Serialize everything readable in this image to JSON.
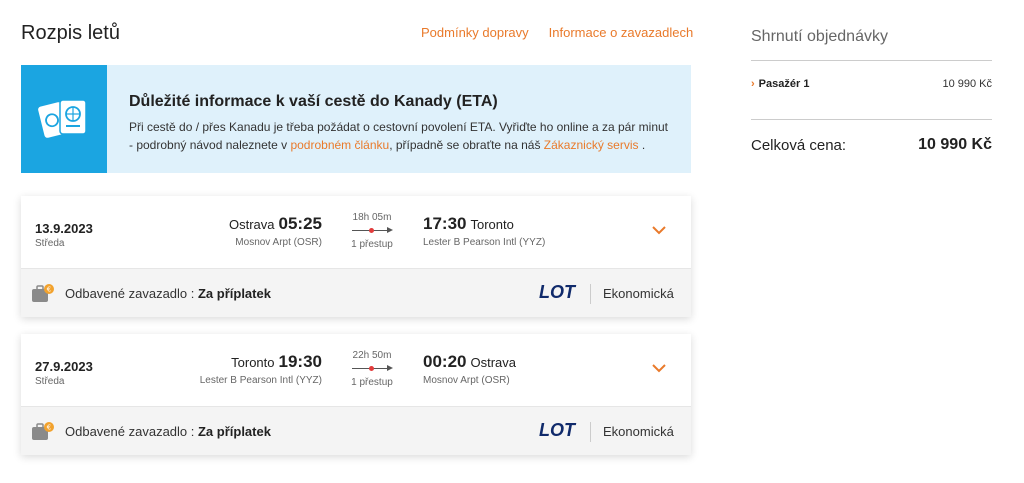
{
  "header": {
    "title": "Rozpis letů",
    "links": [
      "Podmínky dopravy",
      "Informace o zavazadlech"
    ]
  },
  "info": {
    "title": "Důležité informace k vaší cestě do Kanady (ETA)",
    "text_part1": "Při cestě do / přes Kanadu je třeba požádat o cestovní povolení ETA. Vyřiďte ho online a za pár minut - podrobný návod naleznete v ",
    "link1": "podrobném článku",
    "text_part2": ", případně se obraťte na náš ",
    "link2": "Zákaznický servis",
    "text_part3": " .",
    "icon": "passport-icon"
  },
  "flights": [
    {
      "date": "13.9.2023",
      "day": "Středa",
      "from_city": "Ostrava",
      "dep_time": "05:25",
      "from_airport": "Mosnov Arpt (OSR)",
      "duration": "18h 05m",
      "stops": "1 přestup",
      "arr_time": "17:30",
      "to_city": "Toronto",
      "to_airport": "Lester B Pearson Intl (YYZ)",
      "baggage_label": "Odbavené zavazadlo : ",
      "baggage_value": "Za příplatek",
      "airline": "LOT",
      "cabin": "Ekonomická"
    },
    {
      "date": "27.9.2023",
      "day": "Středa",
      "from_city": "Toronto",
      "dep_time": "19:30",
      "from_airport": "Lester B Pearson Intl (YYZ)",
      "duration": "22h 50m",
      "stops": "1 přestup",
      "arr_time": "00:20",
      "to_city": "Ostrava",
      "to_airport": "Mosnov Arpt (OSR)",
      "baggage_label": "Odbavené zavazadlo : ",
      "baggage_value": "Za příplatek",
      "airline": "LOT",
      "cabin": "Ekonomická"
    }
  ],
  "summary": {
    "title": "Shrnutí objednávky",
    "passenger_label": "Pasažér 1",
    "passenger_amount": "10 990 Kč",
    "total_label": "Celková cena:",
    "total_amount": "10 990 Kč"
  },
  "colors": {
    "accent": "#e97a2b",
    "info_bg": "#dff1fb",
    "info_icon_bg": "#1ba5e1",
    "lot_blue": "#102a6b"
  }
}
